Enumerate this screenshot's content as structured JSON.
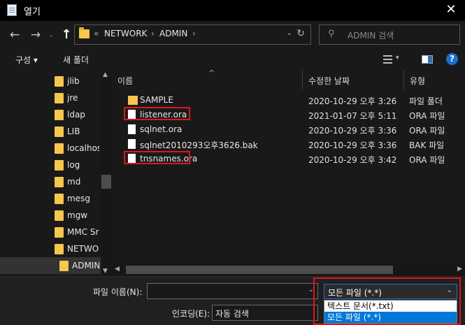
{
  "window": {
    "title": "열기",
    "close_glyph": "✕"
  },
  "nav": {
    "back_glyph": "←",
    "forward_glyph": "→",
    "recent_glyph": "⌄",
    "up_glyph": "↑",
    "breadcrumb_prefix": "«",
    "breadcrumbs": [
      "NETWORK",
      "ADMIN"
    ],
    "breadcrumb_sep": "›",
    "dropdown_glyph": "⌄",
    "refresh_glyph": "↻",
    "search_placeholder": "ADMIN 검색",
    "search_glyph": "⚲"
  },
  "toolbar": {
    "organize_label": "구성 ▾",
    "new_folder_label": "새 폴더",
    "view_dd_glyph": "▾",
    "help_glyph": "?"
  },
  "sidebar": {
    "items": [
      {
        "label": "jlib",
        "selected": false
      },
      {
        "label": "jre",
        "selected": false
      },
      {
        "label": "ldap",
        "selected": false
      },
      {
        "label": "LIB",
        "selected": false
      },
      {
        "label": "localhost",
        "selected": false
      },
      {
        "label": "log",
        "selected": false
      },
      {
        "label": "md",
        "selected": false
      },
      {
        "label": "mesg",
        "selected": false
      },
      {
        "label": "mgw",
        "selected": false
      },
      {
        "label": "MMC Sr",
        "selected": false
      },
      {
        "label": "NETWOR",
        "selected": false
      },
      {
        "label": "ADMIN",
        "selected": true
      }
    ],
    "scroll_up_glyph": "▲",
    "scroll_down_glyph": "▼"
  },
  "columns": {
    "name": "이름",
    "date": "수정한 날짜",
    "type": "유형",
    "sort_glyph": "^"
  },
  "files": [
    {
      "name": "SAMPLE",
      "date": "2020-10-29 오후 3:26",
      "type": "파일 폴더",
      "kind": "folder",
      "highlighted": false
    },
    {
      "name": "listener.ora",
      "date": "2021-01-07 오후 5:11",
      "type": "ORA 파일",
      "kind": "file",
      "highlighted": true
    },
    {
      "name": "sqlnet.ora",
      "date": "2020-10-29 오후 3:36",
      "type": "ORA 파일",
      "kind": "file",
      "highlighted": false
    },
    {
      "name": "sqlnet2010293오후3626.bak",
      "date": "2020-10-29 오후 3:36",
      "type": "BAK 파일",
      "kind": "file",
      "highlighted": false
    },
    {
      "name": "tnsnames.ora",
      "date": "2020-10-29 오후 3:42",
      "type": "ORA 파일",
      "kind": "file",
      "highlighted": true
    }
  ],
  "hscroll": {
    "left_glyph": "◀",
    "right_glyph": "▶"
  },
  "bottom": {
    "filename_label": "파일 이름(N):",
    "filename_value": "",
    "filename_dd_glyph": "⌄",
    "encoding_label": "인코딩(E):",
    "encoding_value": "자동 검색",
    "filetype_selected": "모든 파일 (*.*)",
    "filetype_dd_glyph": "⌄",
    "filetype_options": [
      {
        "label": "텍스트 문서(*.txt)",
        "selected": false
      },
      {
        "label": "모든 파일 (*.*)",
        "selected": true
      }
    ]
  },
  "colors": {
    "highlight": "#e0141b",
    "folder": "#f6c64d",
    "selection": "#0078d7"
  }
}
